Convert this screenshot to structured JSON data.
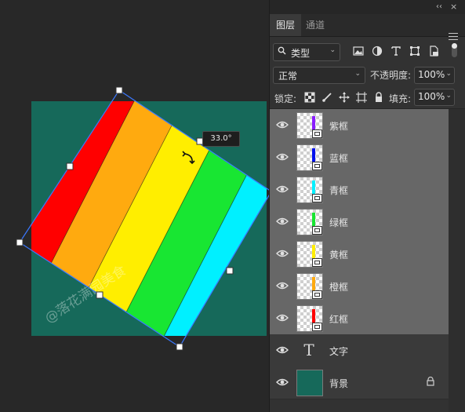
{
  "canvas": {
    "rotation_angle_label": "33.0°",
    "watermark": "@落花满园美食"
  },
  "panel": {
    "collapse_glyph": "‹‹",
    "close_glyph": "×",
    "tabs": [
      {
        "label": "图层",
        "active": true
      },
      {
        "label": "通道",
        "active": false
      }
    ],
    "filter": {
      "label": "类型",
      "icons": [
        "image-filter-icon",
        "adjustment-filter-icon",
        "type-filter-icon",
        "shape-filter-icon",
        "smart-object-filter-icon"
      ]
    },
    "blend_mode": "正常",
    "opacity_label": "不透明度:",
    "opacity_value": "100%",
    "lock_label": "锁定:",
    "fill_label": "填充:",
    "fill_value": "100%",
    "layers": [
      {
        "name": "紫框",
        "type": "smart",
        "color": "#8a1cff",
        "selected": true
      },
      {
        "name": "蓝框",
        "type": "smart",
        "color": "#0011ee",
        "selected": true
      },
      {
        "name": "青框",
        "type": "smart",
        "color": "#00f0ff",
        "selected": true
      },
      {
        "name": "绿框",
        "type": "smart",
        "color": "#18e632",
        "selected": true
      },
      {
        "name": "黄框",
        "type": "smart",
        "color": "#ffee00",
        "selected": true
      },
      {
        "name": "橙框",
        "type": "smart",
        "color": "#ffaa0f",
        "selected": true
      },
      {
        "name": "红框",
        "type": "smart",
        "color": "#ff0000",
        "selected": true
      },
      {
        "name": "文字",
        "type": "text",
        "glyph": "T",
        "selected": false
      },
      {
        "name": "背景",
        "type": "background",
        "color": "#16695a",
        "selected": false,
        "locked": true
      }
    ]
  }
}
